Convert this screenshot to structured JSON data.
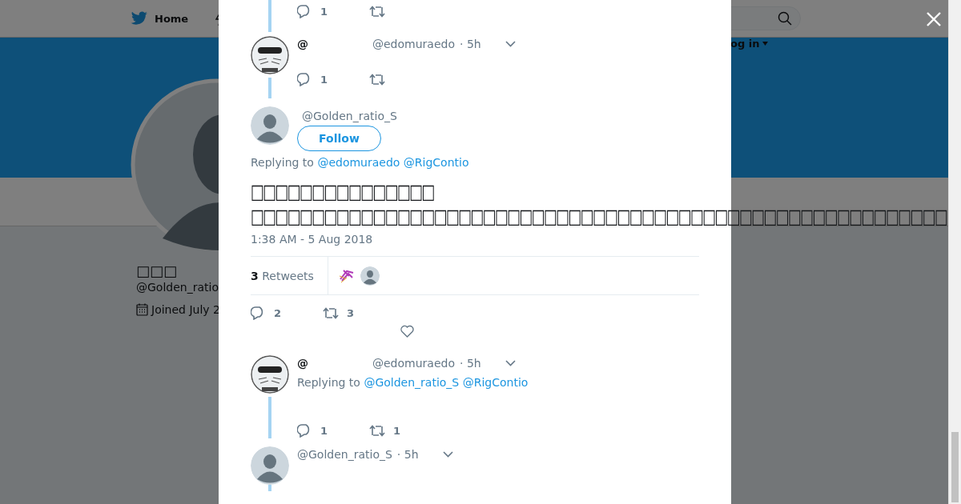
{
  "nav": {
    "home_label": "Home",
    "login_label": "og in"
  },
  "profile": {
    "name": "□□□",
    "handle": "@Golden_ratio",
    "joined": "Joined July 2"
  },
  "top_actions": {
    "replies": "1"
  },
  "tweets": [
    {
      "kind": "compact",
      "avatar": {
        "kind": "cartoon"
      },
      "name": "@",
      "handle": "@edomuraedo",
      "time": "· 5h",
      "replies": "1"
    },
    {
      "kind": "focused",
      "avatar": {
        "kind": "default"
      },
      "handle": "@Golden_ratio_S",
      "follow": "Follow",
      "replying_label": "Replying to",
      "mentions": [
        "@edomuraedo",
        "@RigContio"
      ],
      "text": "□□□□□□□□□□□□□□□\n□□□□□□□□□□□□□□□□□□□□□□□□□□□□□□□□□□□□□□□□□□□□□□□□□□□□□□□□□",
      "timestamp": "1:38 AM - 5 Aug 2018",
      "retweet_count": "3",
      "retweet_label": "Retweets",
      "replies": "2",
      "retweets": "3"
    },
    {
      "kind": "compact",
      "avatar": {
        "kind": "cartoon"
      },
      "name": "@",
      "handle": "@edomuraedo",
      "time": "· 5h",
      "replying_label": "Replying to",
      "mentions": [
        "@Golden_ratio_S",
        "@RigContio"
      ],
      "replies": "1",
      "retweets": "1"
    },
    {
      "kind": "compact",
      "avatar": {
        "kind": "default"
      },
      "handle": "@Golden_ratio_S",
      "time": "· 5h"
    }
  ]
}
